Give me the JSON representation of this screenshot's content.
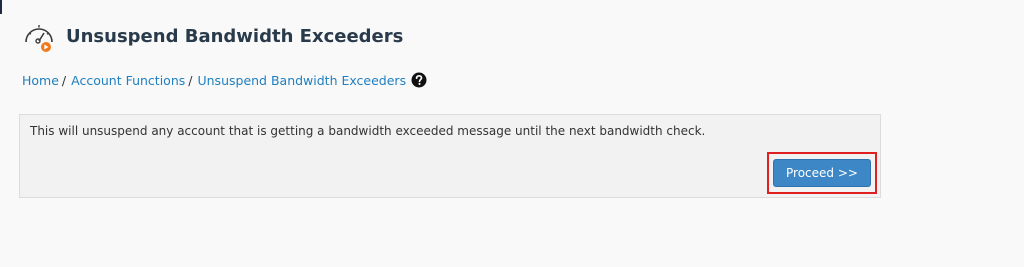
{
  "header": {
    "title": "Unsuspend Bandwidth Exceeders",
    "icon": "gauge-icon"
  },
  "breadcrumb": {
    "items": [
      {
        "label": "Home"
      },
      {
        "label": "Account Functions"
      },
      {
        "label": "Unsuspend Bandwidth Exceeders"
      }
    ],
    "separator": "/",
    "help_icon": "help-circle-icon"
  },
  "panel": {
    "message": "This will unsuspend any account that is getting a bandwidth exceeded message until the next bandwidth check.",
    "proceed_label": "Proceed >>"
  },
  "colors": {
    "link": "#1f7fbf",
    "button": "#3d87c6",
    "highlight": "#e02020",
    "icon_accent": "#f07a1a"
  }
}
